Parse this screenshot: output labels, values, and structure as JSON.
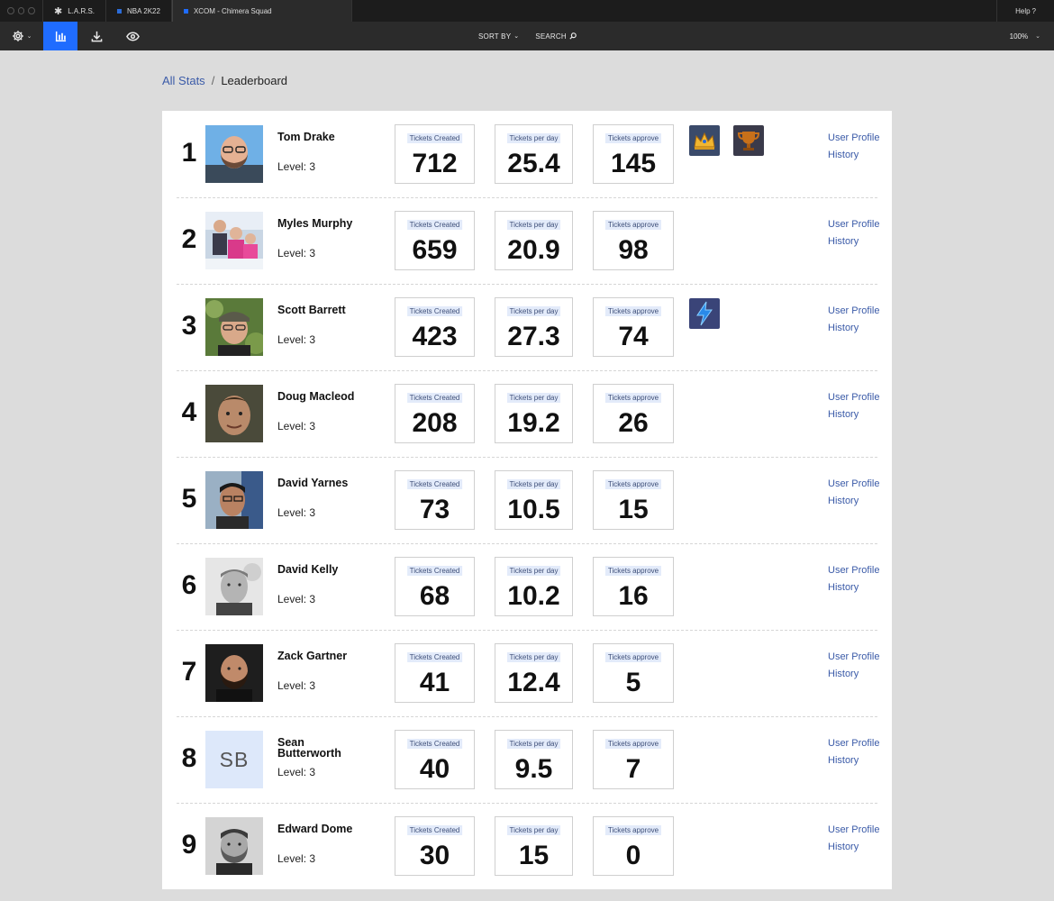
{
  "tabs": [
    {
      "label": "L.A.R.S.",
      "icon": "lars-logo-icon"
    },
    {
      "label": "NBA 2K22",
      "color": "#2b6cd8"
    },
    {
      "label": "XCOM - Chimera Squad",
      "color": "#1f6cff"
    }
  ],
  "help_label": "Help",
  "toolbar": {
    "sort_label": "SORT BY",
    "search_label": "SEARCH",
    "zoom_label": "100%",
    "accent_color": "#1f6cff"
  },
  "breadcrumb": {
    "root": "All Stats",
    "separator": "/",
    "current": "Leaderboard"
  },
  "rows": [
    {
      "rank": "1",
      "name": "Tom Drake",
      "level": "Level: 3",
      "stats": [
        "712",
        "25.4",
        "145"
      ],
      "badges": [
        "crown-badge-icon",
        "trophy-badge-icon"
      ]
    },
    {
      "rank": "2",
      "name": "Myles Murphy",
      "level": "Level: 3",
      "stats": [
        "659",
        "20.9",
        "98"
      ],
      "badges": []
    },
    {
      "rank": "3",
      "name": "Scott Barrett",
      "level": "Level: 3",
      "stats": [
        "423",
        "27.3",
        "74"
      ],
      "badges": [
        "lightning-badge-icon"
      ]
    },
    {
      "rank": "4",
      "name": "Doug Macleod",
      "level": "Level: 3",
      "stats": [
        "208",
        "19.2",
        "26"
      ],
      "badges": []
    },
    {
      "rank": "5",
      "name": "David Yarnes",
      "level": "Level: 3",
      "stats": [
        "73",
        "10.5",
        "15"
      ],
      "badges": []
    },
    {
      "rank": "6",
      "name": "David Kelly",
      "level": "Level: 3",
      "stats": [
        "68",
        "10.2",
        "16"
      ],
      "badges": []
    },
    {
      "rank": "7",
      "name": "Zack Gartner",
      "level": "Level: 3",
      "stats": [
        "41",
        "12.4",
        "5"
      ],
      "badges": []
    },
    {
      "rank": "8",
      "name": "Sean Butterworth",
      "level": "Level: 3",
      "stats": [
        "40",
        "9.5",
        "7"
      ],
      "badges": [],
      "initials": "SB"
    },
    {
      "rank": "9",
      "name": "Edward Dome",
      "level": "Level: 3",
      "stats": [
        "30",
        "15",
        "0"
      ],
      "badges": []
    }
  ],
  "stat_labels": [
    "Tickets Created",
    "Tickets per day",
    "Tickets approve"
  ],
  "link_labels": {
    "profile": "User Profile",
    "history": "History"
  }
}
